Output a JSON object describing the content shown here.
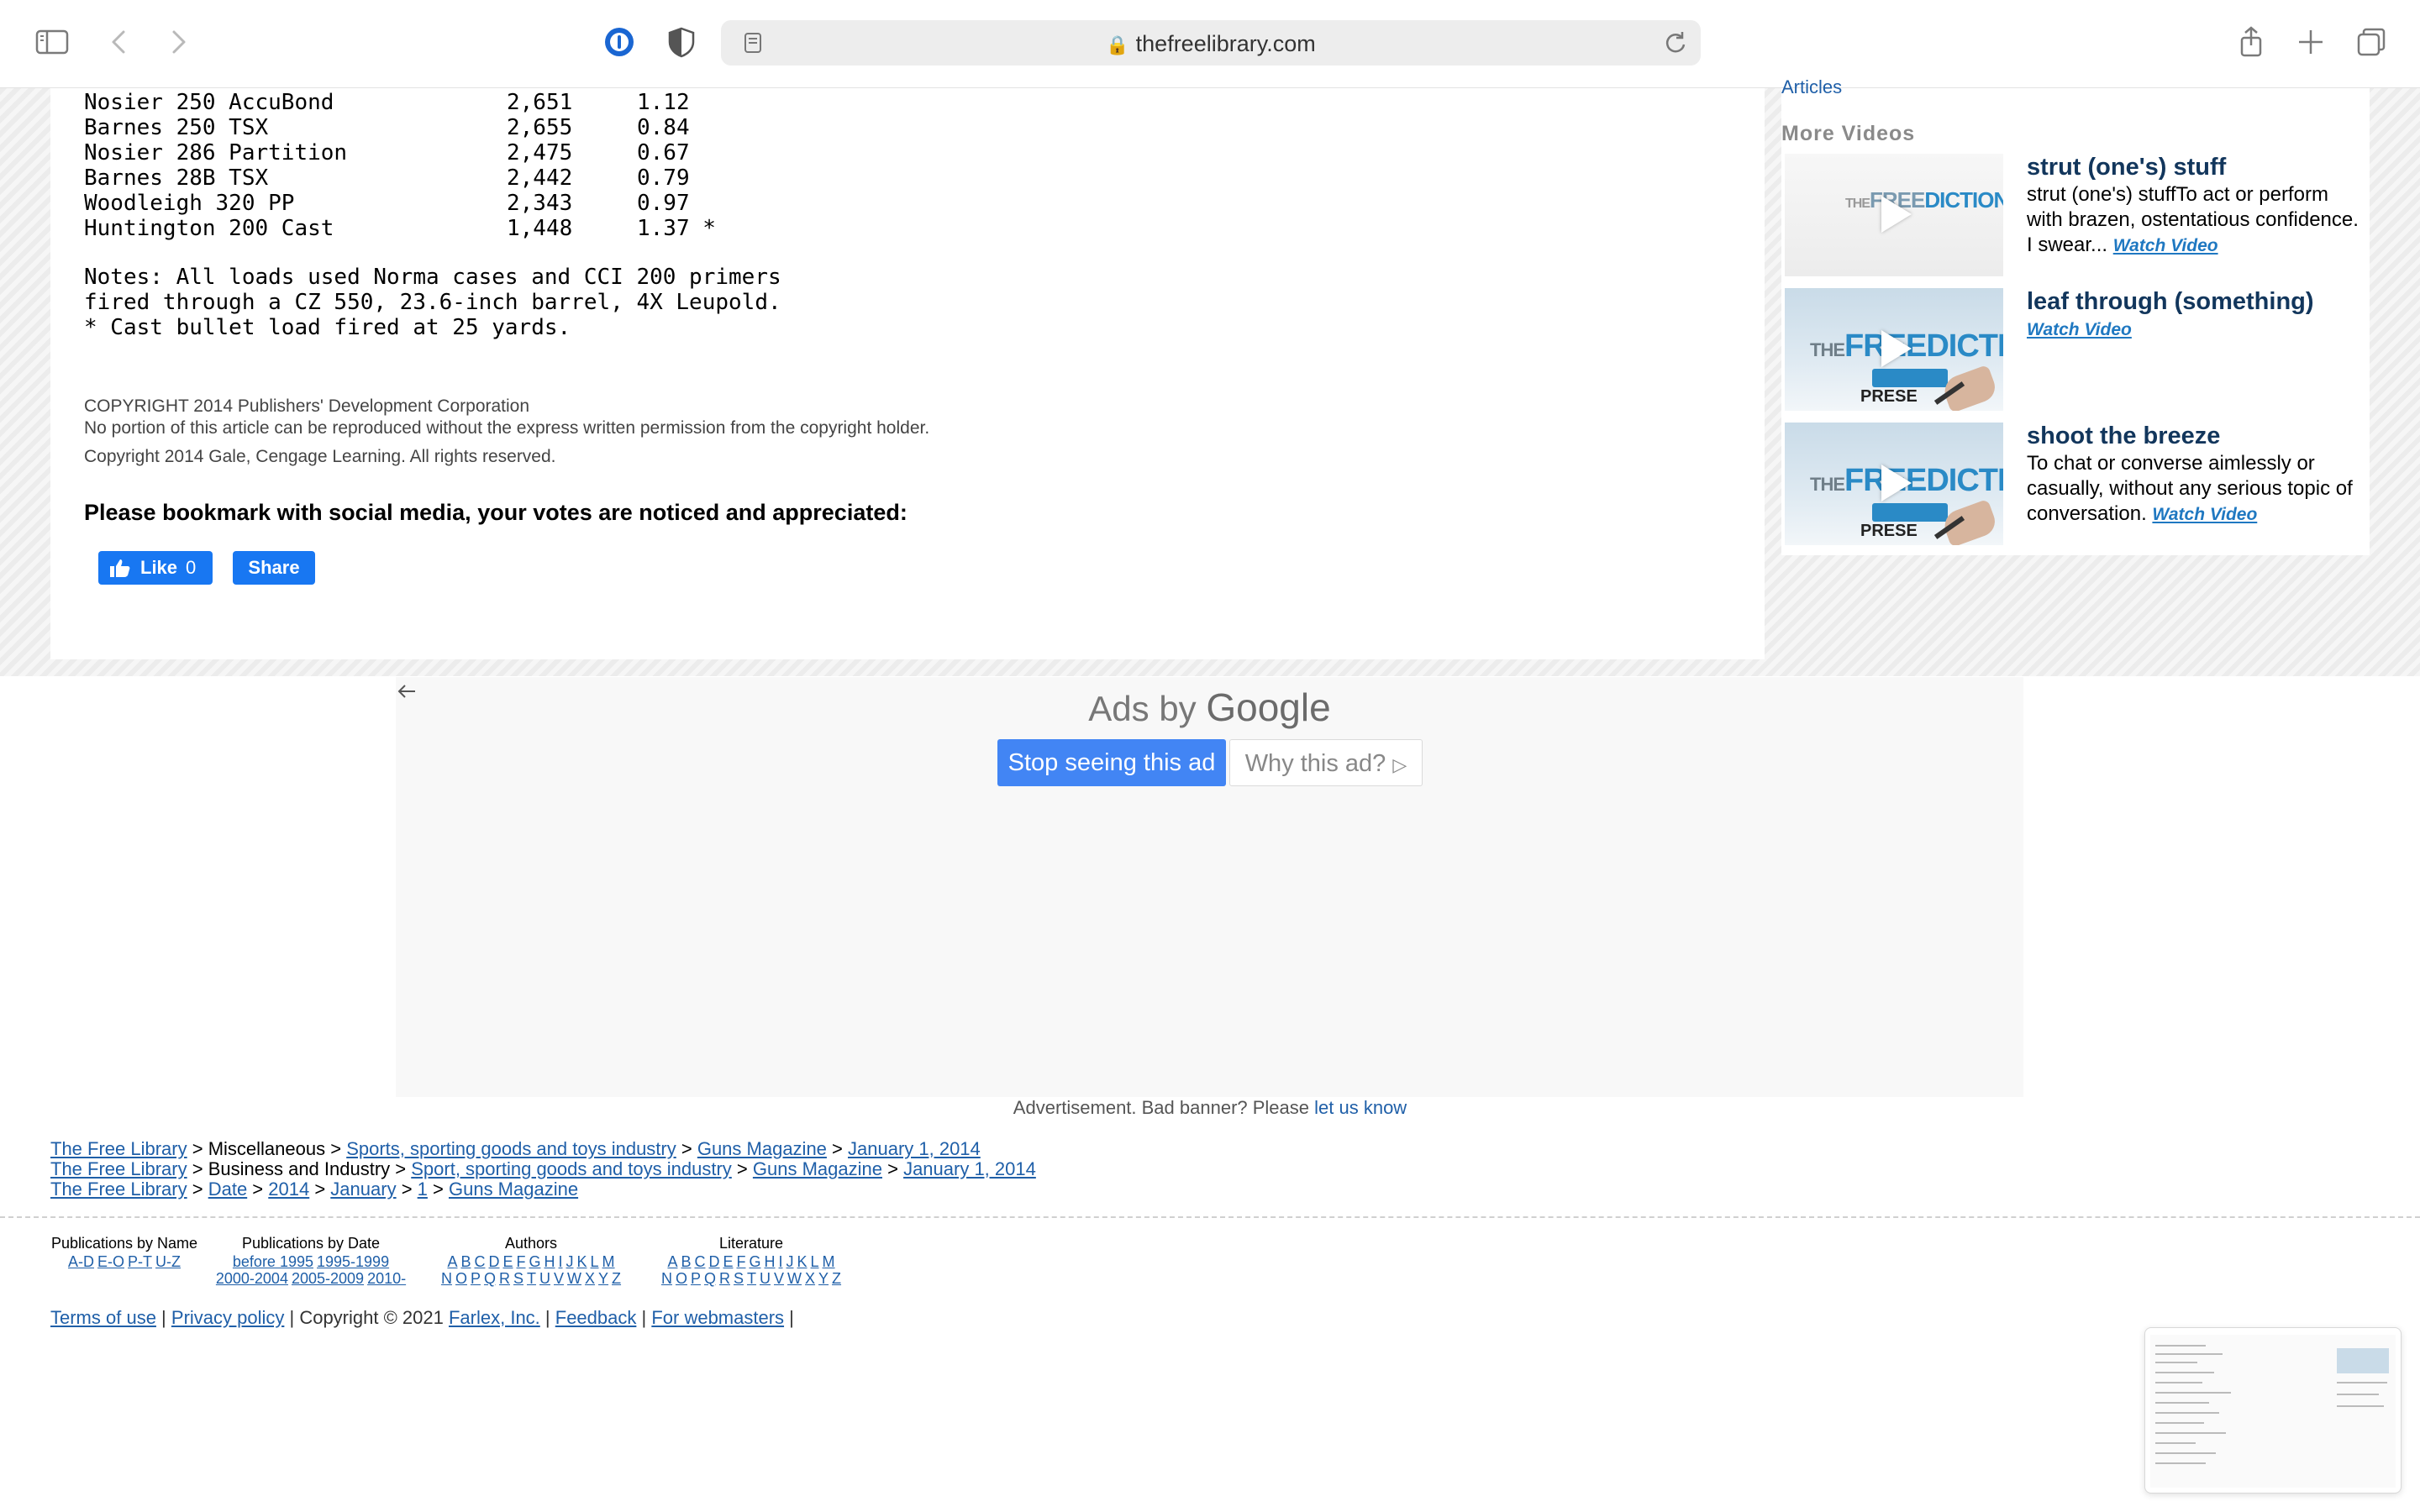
{
  "browser": {
    "url": "thefreelibrary.com"
  },
  "article": {
    "table_rows": [
      {
        "load": "Nosier 250 AccuBond",
        "velocity": "2,651",
        "group": "1.12",
        "mark": ""
      },
      {
        "load": "Barnes 250 TSX",
        "velocity": "2,655",
        "group": "0.84",
        "mark": ""
      },
      {
        "load": "Nosier 286 Partition",
        "velocity": "2,475",
        "group": "0.67",
        "mark": ""
      },
      {
        "load": "Barnes 28B TSX",
        "velocity": "2,442",
        "group": "0.79",
        "mark": ""
      },
      {
        "load": "Woodleigh 320 PP",
        "velocity": "2,343",
        "group": "0.97",
        "mark": ""
      },
      {
        "load": "Huntington 200 Cast",
        "velocity": "1,448",
        "group": "1.37",
        "mark": "*"
      }
    ],
    "notes": [
      "Notes: All loads used Norma cases and CCI 200 primers",
      "fired through a CZ 550, 23.6-inch barrel, 4X Leupold.",
      "* Cast bullet load fired at 25 yards."
    ],
    "copyright_lines": [
      "COPYRIGHT 2014 Publishers' Development Corporation",
      "No portion of this article can be reproduced without the express written permission from the copyright holder.",
      "Copyright 2014 Gale, Cengage Learning. All rights reserved."
    ],
    "bookmark_prompt": "Please bookmark with social media, your votes are noticed and appreciated:",
    "like_label": "Like",
    "like_count": "0",
    "share_label": "Share"
  },
  "sidebar": {
    "top_link": "Articles",
    "section_title": "More Videos",
    "videos": [
      {
        "title": "strut (one's) stuff",
        "desc": "strut (one's) stuffTo act or perform with brazen, ostentatious confidence. I swear...",
        "watch": "Watch Video"
      },
      {
        "title": "leaf through (something)",
        "desc": "",
        "watch": "Watch Video"
      },
      {
        "title": "shoot the breeze",
        "desc": "To chat or converse aimlessly or casually, without any serious topic of conversation.",
        "watch": "Watch Video"
      }
    ],
    "thumb_logo": "THEFREEDICTIONARY",
    "thumb_sub": "PRESE"
  },
  "ad": {
    "ads_by": "Ads by",
    "google": "Google",
    "stop_label": "Stop seeing this ad",
    "why_label": "Why this ad?",
    "note": "Advertisement. Bad banner? Please",
    "note_link": "let us know"
  },
  "breadcrumbs": [
    [
      "The Free Library",
      "Miscellaneous",
      "Sports, sporting goods and toys industry",
      "Guns Magazine",
      "January 1, 2014"
    ],
    [
      "The Free Library",
      "Business and Industry",
      "Sport, sporting goods and toys industry",
      "Guns Magazine",
      "January 1, 2014"
    ],
    [
      "The Free Library",
      "Date",
      "2014",
      "January",
      "1",
      "Guns Magazine"
    ]
  ],
  "footer_index": {
    "by_name": {
      "title": "Publications by Name",
      "links": [
        "A-D",
        "E-O",
        "P-T",
        "U-Z"
      ]
    },
    "by_date": {
      "title": "Publications by Date",
      "row1": [
        "before 1995",
        "1995-1999"
      ],
      "row2": [
        "2000-2004",
        "2005-2009",
        "2010-"
      ]
    },
    "authors": {
      "title": "Authors",
      "row1": [
        "A",
        "B",
        "C",
        "D",
        "E",
        "F",
        "G",
        "H",
        "I",
        "J",
        "K",
        "L",
        "M"
      ],
      "row2": [
        "N",
        "O",
        "P",
        "Q",
        "R",
        "S",
        "T",
        "U",
        "V",
        "W",
        "X",
        "Y",
        "Z"
      ]
    },
    "literature": {
      "title": "Literature",
      "row1": [
        "A",
        "B",
        "C",
        "D",
        "E",
        "F",
        "G",
        "H",
        "I",
        "J",
        "K",
        "L",
        "M"
      ],
      "row2": [
        "N",
        "O",
        "P",
        "Q",
        "R",
        "S",
        "T",
        "U",
        "V",
        "W",
        "X",
        "Y",
        "Z"
      ]
    }
  },
  "footer": {
    "terms": "Terms of use",
    "privacy": "Privacy policy",
    "copyright": "Copyright © 2021",
    "farlex": "Farlex, Inc.",
    "feedback": "Feedback",
    "webmasters": "For webmasters"
  },
  "colors": {
    "link": "#1f5fa8",
    "facebook": "#1877f2",
    "google_blue": "#4285f4",
    "video_title": "#12365c"
  }
}
